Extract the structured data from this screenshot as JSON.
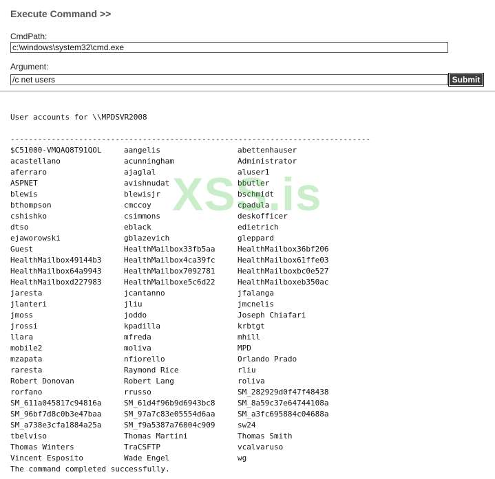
{
  "header": {
    "title": "Execute Command >>"
  },
  "form": {
    "cmdpath_label": "CmdPath:",
    "cmdpath_value": "c:\\windows\\system32\\cmd.exe",
    "argument_label": "Argument:",
    "argument_value": "/c net users",
    "submit_label": "Submit"
  },
  "output": {
    "heading": "User accounts for \\\\MPDSVR2008",
    "separator": "-------------------------------------------------------------------------------",
    "accounts": [
      [
        "$C51000-VMQAQ8T91QOL",
        "aangelis",
        "abettenhauser"
      ],
      [
        "acastellano",
        "acunningham",
        "Administrator"
      ],
      [
        "aferraro",
        "ajaglal",
        "aluser1"
      ],
      [
        "ASPNET",
        "avishnudat",
        "bbutler"
      ],
      [
        "blewis",
        "blewisjr",
        "bschmidt"
      ],
      [
        "bthompson",
        "cmccoy",
        "cpadula"
      ],
      [
        "cshishko",
        "csimmons",
        "deskofficer"
      ],
      [
        "dtso",
        "eblack",
        "edietrich"
      ],
      [
        "ejaworowski",
        "gblazevich",
        "gleppard"
      ],
      [
        "Guest",
        "HealthMailbox33fb5aa",
        "HealthMailbox36bf206"
      ],
      [
        "HealthMailbox49144b3",
        "HealthMailbox4ca39fc",
        "HealthMailbox61ffe03"
      ],
      [
        "HealthMailbox64a9943",
        "HealthMailbox7092781",
        "HealthMailboxbc0e527"
      ],
      [
        "HealthMailboxd227983",
        "HealthMailboxe5c6d22",
        "HealthMailboxeb350ac"
      ],
      [
        "jaresta",
        "jcantanno",
        "jfalanga"
      ],
      [
        "jlanteri",
        "jliu",
        "jmcnelis"
      ],
      [
        "jmoss",
        "joddo",
        "Joseph Chiafari"
      ],
      [
        "jrossi",
        "kpadilla",
        "krbtgt"
      ],
      [
        "llara",
        "mfreda",
        "mhill"
      ],
      [
        "mobile2",
        "moliva",
        "MPD"
      ],
      [
        "mzapata",
        "nfiorello",
        "Orlando Prado"
      ],
      [
        "raresta",
        "Raymond Rice",
        "rliu"
      ],
      [
        "Robert Donovan",
        "Robert Lang",
        "roliva"
      ],
      [
        "rorfano",
        "rrusso",
        "SM_282929d0f47f48438"
      ],
      [
        "SM_611a045817c94816a",
        "SM_61d4f96b9d6943bc8",
        "SM_8a59c37e64744108a"
      ],
      [
        "SM_96bf7d8c0b3e47baa",
        "SM_97a7c83e05554d6aa",
        "SM_a3fc695884c04688a"
      ],
      [
        "SM_a738e3cfa1884a25a",
        "SM_f9a5387a76004c909",
        "sw24"
      ],
      [
        "tbelviso",
        "Thomas Martini",
        "Thomas Smith"
      ],
      [
        "Thomas Winters",
        "TraCSFTP",
        "vcalvaruso"
      ],
      [
        "Vincent Esposito",
        "Wade Engel",
        "wg"
      ]
    ],
    "footer": "The command completed successfully."
  },
  "watermark": {
    "text": "XSS.is",
    "color": "#5ac85a"
  }
}
